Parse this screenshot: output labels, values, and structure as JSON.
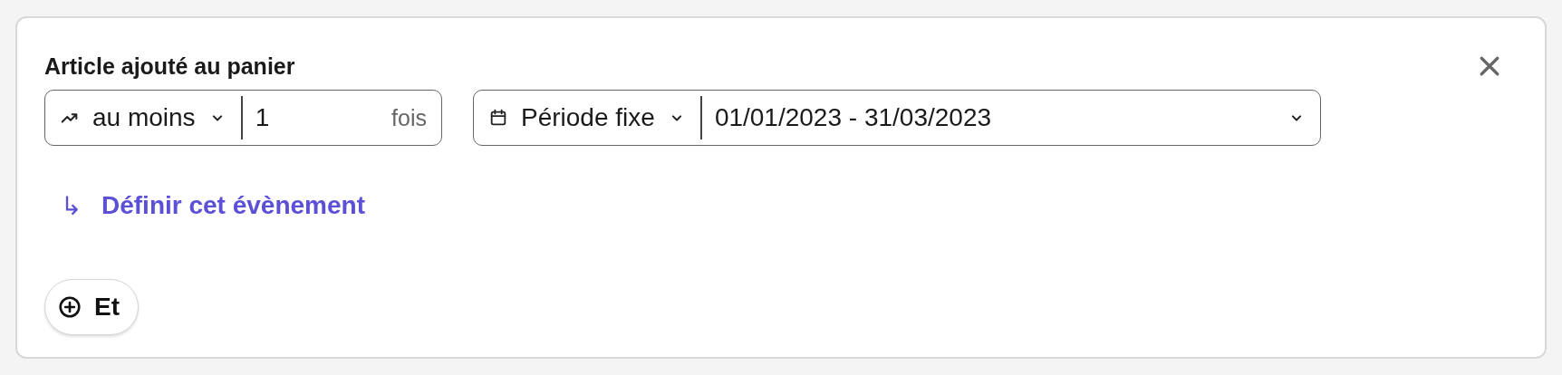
{
  "title": "Article ajouté au panier",
  "frequency": {
    "operator": "au moins",
    "count": "1",
    "unit": "fois"
  },
  "period": {
    "mode": "Période fixe",
    "range": "01/01/2023 - 31/03/2023"
  },
  "define_link": {
    "arrow": "↳",
    "label": "Définir cet évènement"
  },
  "add_button": {
    "label": "Et"
  }
}
